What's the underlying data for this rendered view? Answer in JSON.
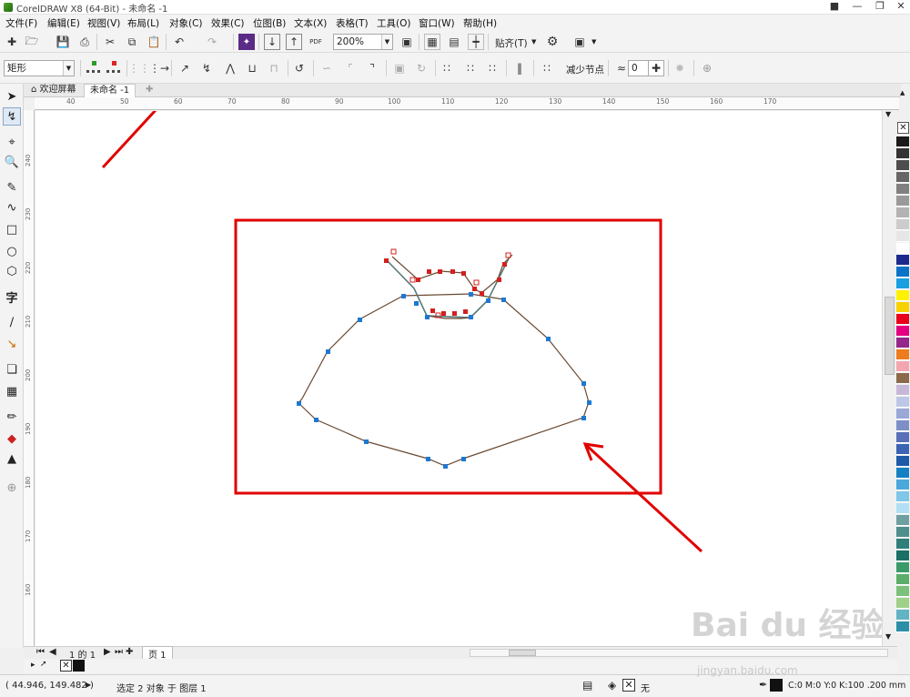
{
  "window": {
    "title": "CorelDRAW X8 (64-Bit) - 未命名 -1"
  },
  "menu": [
    "文件(F)",
    "编辑(E)",
    "视图(V)",
    "布局(L)",
    "对象(C)",
    "效果(C)",
    "位图(B)",
    "文本(X)",
    "表格(T)",
    "工具(O)",
    "窗口(W)",
    "帮助(H)"
  ],
  "toolbar": {
    "zoom": "200%",
    "snap_label": "贴齐(T)",
    "pdf_label": "PDF"
  },
  "propbar": {
    "shape_select": "矩形",
    "reduce_nodes_label": "减少节点",
    "smooth_value": "0"
  },
  "tabs": {
    "welcome": "欢迎屏幕",
    "document": "未命名 -1"
  },
  "ruler": {
    "h_labels": [
      "40",
      "50",
      "60",
      "70",
      "80",
      "90",
      "100",
      "110",
      "120",
      "130",
      "140",
      "150",
      "160",
      "170"
    ],
    "v_labels": [
      "240",
      "230",
      "220",
      "210",
      "200",
      "190",
      "180",
      "170",
      "160"
    ]
  },
  "pagenav": {
    "page_of": "1 的 1",
    "page_tab": "页 1"
  },
  "status": {
    "coords": "( 44.946, 149.482 )",
    "selection": "选定 2 对象 于 图层 1",
    "fill_none": "无",
    "outline": "C:0 M:0 Y:0 K:100  .200 mm"
  },
  "watermark": {
    "brand": "Bai du 经验",
    "url": "jingyan.baidu.com"
  },
  "colors": {
    "accent": "#e00000",
    "node_blue": "#1e78d2",
    "node_red": "#d41f1f",
    "curve": "#6b4a32"
  },
  "palette": [
    "#1a1a1a",
    "#333333",
    "#4d4d4d",
    "#666666",
    "#808080",
    "#999999",
    "#b3b3b3",
    "#cccccc",
    "#e6e6e6",
    "#ffffff",
    "#1b2a8c",
    "#0a73c8",
    "#19a0e0",
    "#fff200",
    "#f7d200",
    "#e8001c",
    "#e4007f",
    "#95268a",
    "#ed7c1f",
    "#f4a6b0",
    "#8b6a4c",
    "#c8b8d8",
    "#bfc7e6",
    "#9aa8d8",
    "#7e8fc8",
    "#5970b8",
    "#3a64b4",
    "#1d5aa8",
    "#1680c4",
    "#4ba8dc",
    "#7fc6e9",
    "#b2dff3",
    "#6f9fa0",
    "#4f8f8d",
    "#2f7f7a",
    "#1a6f66",
    "#3a9a6a",
    "#5aae6a",
    "#7cc07a",
    "#9fd08a",
    "#62b3c4",
    "#2c8fa6"
  ]
}
